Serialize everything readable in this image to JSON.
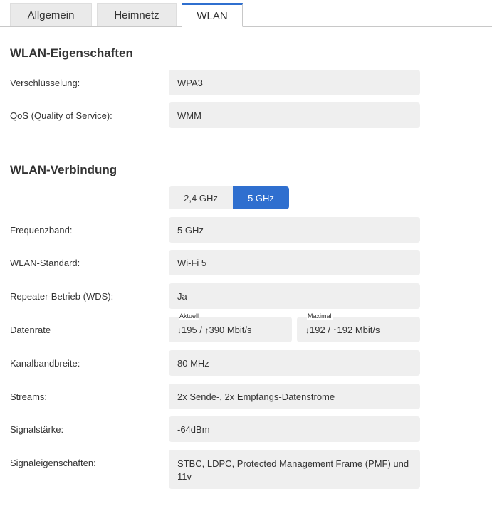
{
  "tabs": [
    {
      "label": "Allgemein",
      "active": false
    },
    {
      "label": "Heimnetz",
      "active": false
    },
    {
      "label": "WLAN",
      "active": true
    }
  ],
  "accent_color": "#2f6fcf",
  "properties": {
    "title": "WLAN-Eigenschaften",
    "rows": [
      {
        "label": "Verschlüsselung:",
        "value": "WPA3"
      },
      {
        "label": "QoS (Quality of Service):",
        "value": "WMM"
      }
    ]
  },
  "connection": {
    "title": "WLAN-Verbindung",
    "bands": [
      {
        "label": "2,4 GHz",
        "selected": false
      },
      {
        "label": "5 GHz",
        "selected": true
      }
    ],
    "rows": {
      "frequenzband": {
        "label": "Frequenzband:",
        "value": "5 GHz"
      },
      "standard": {
        "label": "WLAN-Standard:",
        "value": "Wi-Fi 5"
      },
      "repeater": {
        "label": "Repeater-Betrieb (WDS):",
        "value": "Ja"
      },
      "datenrate": {
        "label": "Datenrate",
        "aktuell": {
          "caption": "Aktuell",
          "down_arrow": "↓",
          "down": "195",
          "sep": " / ",
          "up_arrow": "↑",
          "up": "390 Mbit/s"
        },
        "maximal": {
          "caption": "Maximal",
          "down_arrow": "↓",
          "down": "192",
          "sep": " / ",
          "up_arrow": "↑",
          "up": "192 Mbit/s"
        }
      },
      "kanal": {
        "label": "Kanalbandbreite:",
        "value": "80 MHz"
      },
      "streams": {
        "label": "Streams:",
        "value": "2x Sende-, 2x Empfangs-Datenströme"
      },
      "signal": {
        "label": "Signalstärke:",
        "value": "-64dBm"
      },
      "eigenschaften": {
        "label": "Signaleigenschaften:",
        "value": "STBC, LDPC, Protected Management Frame (PMF) und 11v"
      }
    }
  }
}
